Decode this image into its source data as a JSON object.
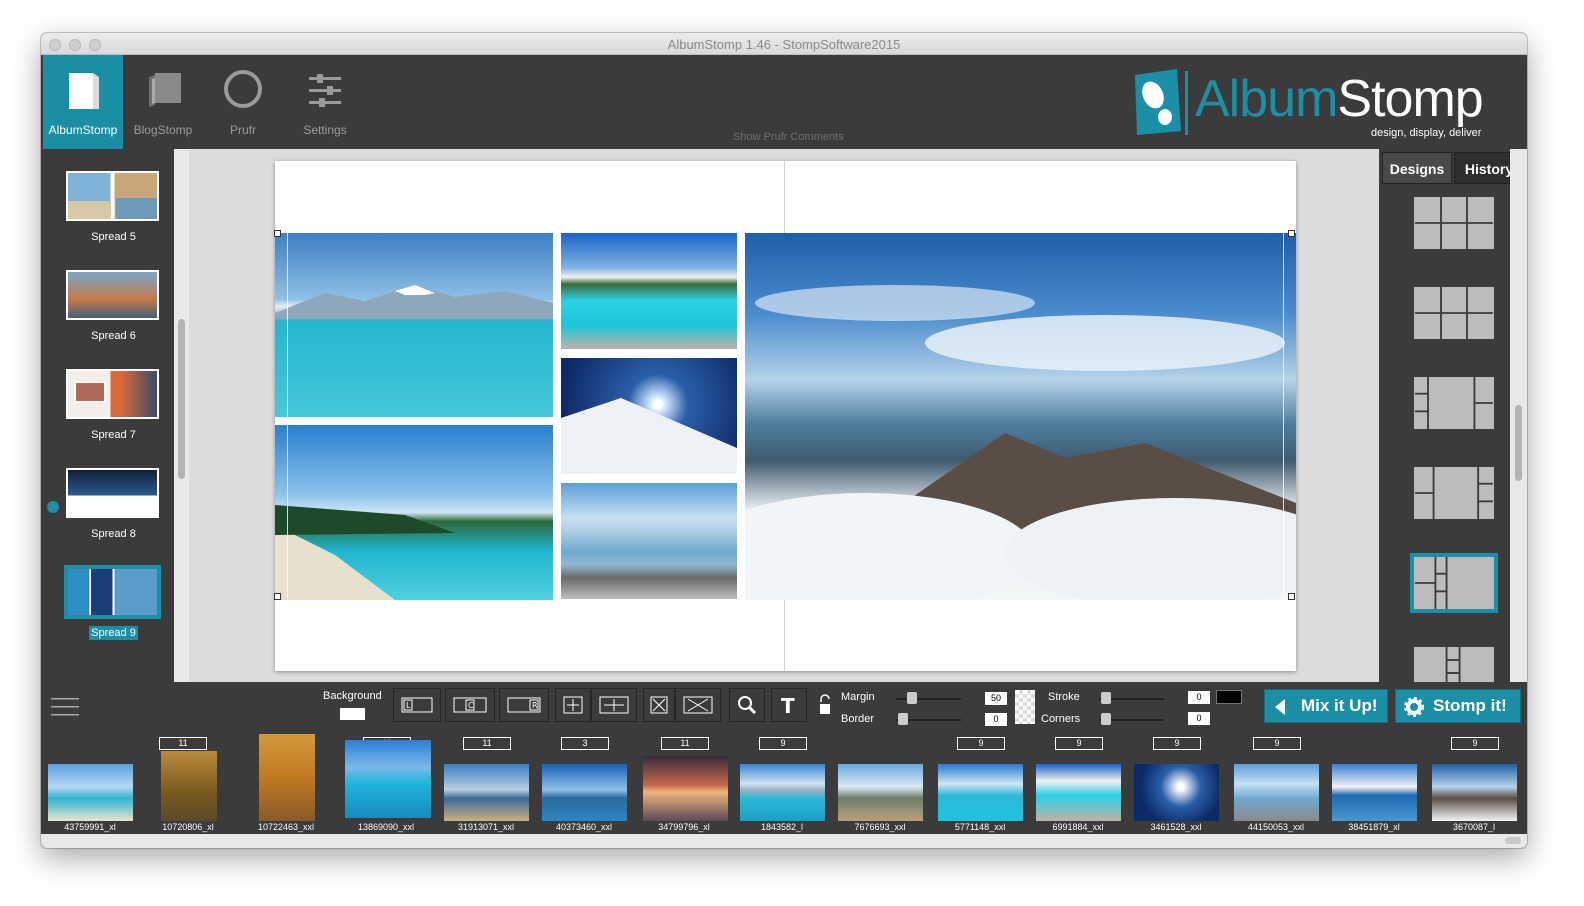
{
  "window": {
    "title": "AlbumStomp 1.46 - StompSoftware2015"
  },
  "nav": {
    "items": [
      {
        "label": "AlbumStomp",
        "icon": "album-icon"
      },
      {
        "label": "BlogStomp",
        "icon": "blog-icon"
      },
      {
        "label": "Prufr",
        "icon": "circle-icon"
      },
      {
        "label": "Settings",
        "icon": "sliders-icon"
      }
    ],
    "show_prufr_comments": "Show Prufr Comments"
  },
  "brand": {
    "name_part1": "Album",
    "name_part2": "Stomp",
    "tagline": "design, display, deliver",
    "color": "#1b8fa6"
  },
  "sidebar": {
    "spreads": [
      {
        "label": "Spread 5"
      },
      {
        "label": "Spread 6"
      },
      {
        "label": "Spread 7"
      },
      {
        "label": "Spread 8"
      },
      {
        "label": "Spread 9"
      }
    ],
    "add_label": "+",
    "remove_label": "✕"
  },
  "right_panel": {
    "tabs": [
      {
        "label": "Designs"
      },
      {
        "label": "History"
      }
    ]
  },
  "toolbar": {
    "background_label": "Background",
    "margin_label": "Margin",
    "margin_value": "50",
    "border_label": "Border",
    "border_value": "0",
    "stroke_label": "Stroke",
    "stroke_value": "0",
    "corners_label": "Corners",
    "corners_value": "0",
    "mix_label": "Mix it Up!",
    "stomp_label": "Stomp it!"
  },
  "filmstrip": [
    {
      "badge": "",
      "name": "43759991_xl"
    },
    {
      "badge": "11",
      "name": "10720806_xl"
    },
    {
      "badge": "",
      "name": "10722463_xxl"
    },
    {
      "badge": "11",
      "name": "13869090_xxl"
    },
    {
      "badge": "11",
      "name": "31913071_xxl"
    },
    {
      "badge": "3",
      "name": "40373460_xxl"
    },
    {
      "badge": "11",
      "name": "34799796_xl"
    },
    {
      "badge": "9",
      "name": "1843582_l"
    },
    {
      "badge": "",
      "name": "7676693_xxl"
    },
    {
      "badge": "9",
      "name": "5771148_xxl"
    },
    {
      "badge": "9",
      "name": "6991884_xxl"
    },
    {
      "badge": "9",
      "name": "3461528_xxl"
    },
    {
      "badge": "9",
      "name": "44150053_xxl"
    },
    {
      "badge": "",
      "name": "38451879_xl"
    },
    {
      "badge": "9",
      "name": "3670087_l"
    }
  ]
}
